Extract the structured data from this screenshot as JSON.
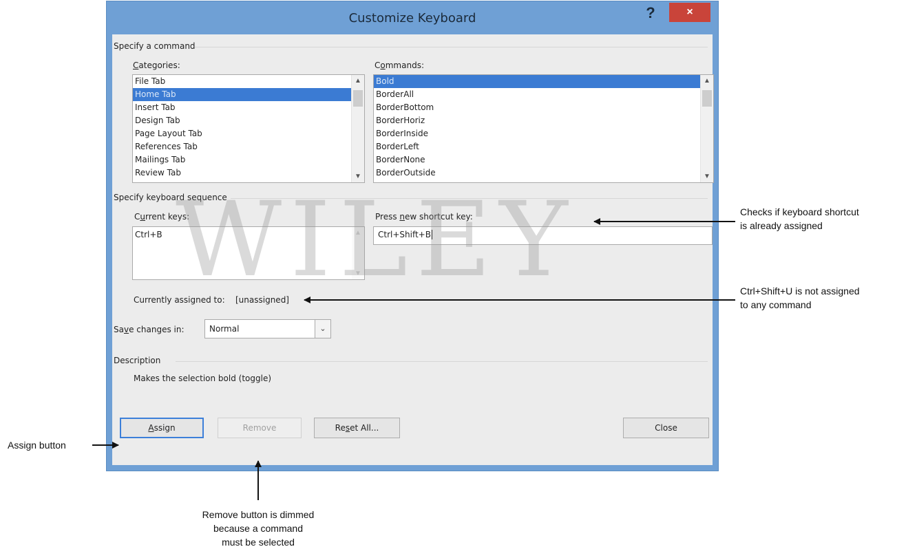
{
  "window": {
    "title": "Customize Keyboard",
    "help_label": "?",
    "close_label": "×"
  },
  "specify_command": {
    "heading": "Specify a command",
    "categories_label_pre": "",
    "categories_label_u": "C",
    "categories_label_post": "ategories:",
    "categories": [
      "File Tab",
      "Home Tab",
      "Insert Tab",
      "Design Tab",
      "Page Layout Tab",
      "References Tab",
      "Mailings Tab",
      "Review Tab"
    ],
    "categories_selected": "Home Tab",
    "commands_label_pre": "C",
    "commands_label_u": "o",
    "commands_label_post": "mmands:",
    "commands": [
      "Bold",
      "BorderAll",
      "BorderBottom",
      "BorderHoriz",
      "BorderInside",
      "BorderLeft",
      "BorderNone",
      "BorderOutside"
    ],
    "commands_selected": "Bold"
  },
  "keyboard_sequence": {
    "heading": "Specify keyboard sequence",
    "current_keys_label_pre": "C",
    "current_keys_label_u": "u",
    "current_keys_label_post": "rrent keys:",
    "current_keys": [
      "Ctrl+B"
    ],
    "new_key_label_pre": "Press ",
    "new_key_label_u": "n",
    "new_key_label_post": "ew shortcut key:",
    "new_key_value": "Ctrl+Shift+B",
    "assigned_label": "Currently assigned to:",
    "assigned_value": "[unassigned]"
  },
  "save_changes": {
    "label_pre": "Sa",
    "label_u": "v",
    "label_post": "e changes in:",
    "value": "Normal"
  },
  "description": {
    "heading": "Description",
    "text": "Makes the selection bold (toggle)"
  },
  "buttons": {
    "assign_u": "A",
    "assign_post": "ssign",
    "remove": "Remove",
    "reset_pre": "Re",
    "reset_u": "s",
    "reset_post": "et All...",
    "close": "Close"
  },
  "watermark": "WILEY",
  "callouts": {
    "checks_line1": "Checks if keyboard shortcut",
    "checks_line2": "is already assigned",
    "unassigned_line1": "Ctrl+Shift+U is not assigned",
    "unassigned_line2": "to any command",
    "assign_button": "Assign button",
    "remove_line1": "Remove button is dimmed",
    "remove_line2": "because a command",
    "remove_line3": "must be selected"
  }
}
